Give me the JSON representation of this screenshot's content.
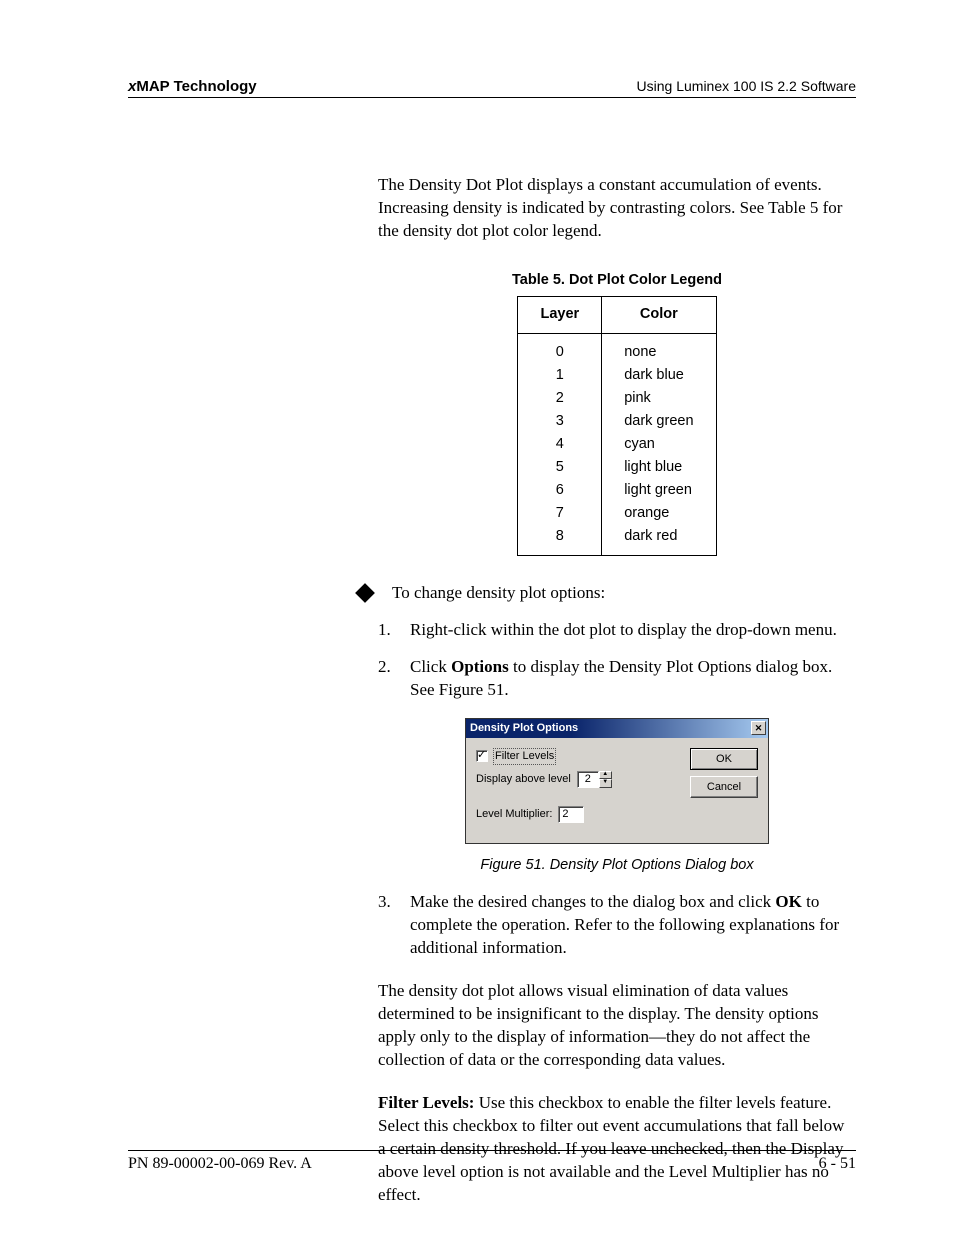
{
  "header": {
    "brand_x": "x",
    "brand_rest": "MAP Technology",
    "right": "Using Luminex 100 IS 2.2 Software"
  },
  "intro_paragraph": "The Density Dot Plot displays a constant accumulation of events. Increasing density is indicated by contrasting colors. See Table 5 for the density dot plot color legend.",
  "table": {
    "caption": "Table 5.  Dot Plot Color Legend",
    "head_layer": "Layer",
    "head_color": "Color",
    "rows": [
      {
        "layer": "0",
        "color": "none"
      },
      {
        "layer": "1",
        "color": "dark blue"
      },
      {
        "layer": "2",
        "color": "pink"
      },
      {
        "layer": "3",
        "color": "dark green"
      },
      {
        "layer": "4",
        "color": "cyan"
      },
      {
        "layer": "5",
        "color": "light blue"
      },
      {
        "layer": "6",
        "color": "light green"
      },
      {
        "layer": "7",
        "color": "orange"
      },
      {
        "layer": "8",
        "color": "dark red"
      }
    ]
  },
  "lead_in": "To change density plot options:",
  "steps": {
    "s1_num": "1.",
    "s1_text": "Right-click within the dot plot to display the drop-down menu.",
    "s2_num": "2.",
    "s2_pre": "Click ",
    "s2_bold": "Options",
    "s2_post": " to display the Density Plot Options dialog box. See Figure 51.",
    "s3_num": "3.",
    "s3_pre": "Make the desired changes to the dialog box and click ",
    "s3_bold": "OK",
    "s3_post": " to complete the operation. Refer to the following explanations for additional information."
  },
  "dialog": {
    "title": "Density Plot Options",
    "close": "✕",
    "filter_label": "Filter Levels",
    "display_label": "Display above level",
    "display_value": "2",
    "multiplier_label": "Level Multiplier:",
    "multiplier_value": "2",
    "ok": "OK",
    "cancel": "Cancel"
  },
  "figure_caption": "Figure 51.  Density Plot Options Dialog box",
  "para2": "The density dot plot allows visual elimination of data values determined to be insignificant to the display. The density options apply only to the display of information—they do not affect the collection of data or the corresponding data values.",
  "para3_bold": "Filter Levels:",
  "para3_text": " Use this checkbox to enable the filter levels feature. Select this checkbox to filter out event accumulations that fall below a certain density threshold. If you leave unchecked, then the Display above level option is not available and the Level Multiplier has no effect.",
  "footer": {
    "left": "PN 89-00002-00-069 Rev. A",
    "right": "6 - 51"
  }
}
